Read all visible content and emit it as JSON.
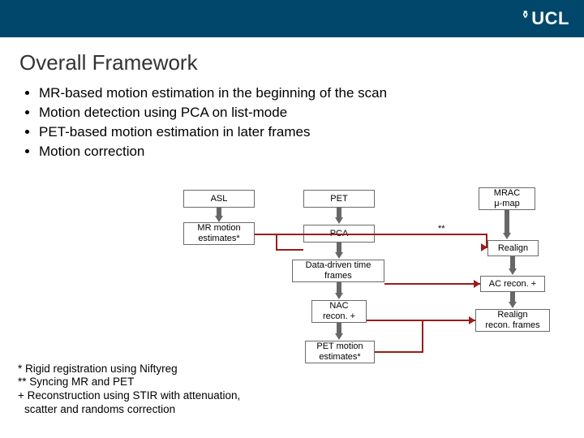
{
  "header": {
    "logo_text": "UCL",
    "logo_torch": "⚱"
  },
  "title": "Overall Framework",
  "bullets": [
    "MR-based motion estimation in the beginning of the scan",
    "Motion detection using PCA on list-mode",
    "PET-based motion estimation in later frames",
    "Motion correction"
  ],
  "boxes": {
    "asl": "ASL",
    "pet": "PET",
    "mrac": "MRAC\nμ-map",
    "mr_motion": "MR motion\nestimates*",
    "pca": "PCA",
    "realign": "Realign",
    "ddt": "Data-driven time\nframes",
    "ac_recon": "AC recon. +",
    "nac": "NAC\nrecon. +",
    "realign_recon": "Realign\nrecon. frames",
    "pet_motion": "PET motion\nestimates*"
  },
  "labels": {
    "sync_marker": "**"
  },
  "footnotes": {
    "f1": "* Rigid registration using Niftyreg",
    "f2": "** Syncing MR and PET",
    "f3": "+ Reconstruction using STIR with attenuation,",
    "f3b": "  scatter and randoms correction"
  }
}
